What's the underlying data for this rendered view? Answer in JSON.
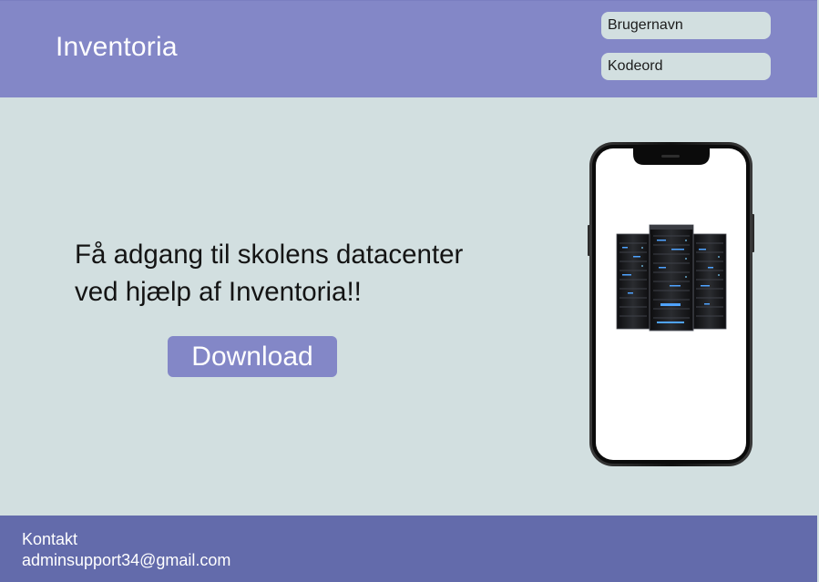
{
  "header": {
    "brand": "Inventoria",
    "username_placeholder": "Brugernavn",
    "password_placeholder": "Kodeord"
  },
  "hero": {
    "headline_line1": "Få adgang til skolens datacenter",
    "headline_line2": "ved hjælp af Inventoria!!",
    "download_label": "Download"
  },
  "phone": {
    "screen_image": "server-rack-icon"
  },
  "footer": {
    "contact_title": "Kontakt",
    "contact_email": "adminsupport34@gmail.com"
  },
  "colors": {
    "header_bg": "#8387c7",
    "body_bg": "#d2dfe0",
    "footer_bg": "#636bab",
    "button_bg": "#8387c7",
    "field_bg": "#d2dfe0"
  }
}
